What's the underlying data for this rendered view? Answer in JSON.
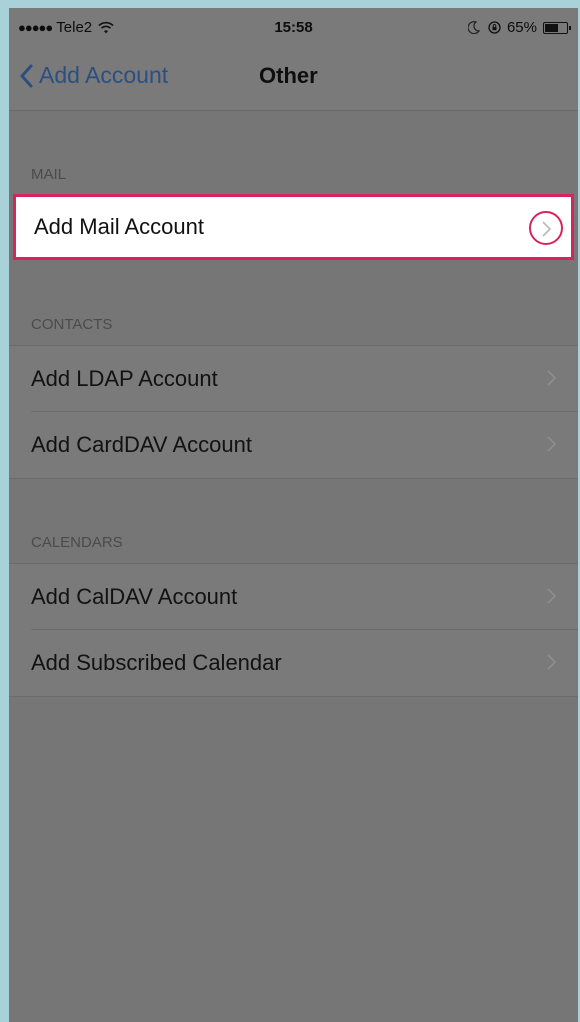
{
  "status_bar": {
    "signal": "●●●●●",
    "carrier": "Tele2",
    "time": "15:58",
    "battery": "65%"
  },
  "nav": {
    "back_label": "Add Account",
    "title": "Other"
  },
  "sections": [
    {
      "header": "MAIL",
      "items": [
        {
          "label": "Add Mail Account"
        }
      ]
    },
    {
      "header": "CONTACTS",
      "items": [
        {
          "label": "Add LDAP Account"
        },
        {
          "label": "Add CardDAV Account"
        }
      ]
    },
    {
      "header": "CALENDARS",
      "items": [
        {
          "label": "Add CalDAV Account"
        },
        {
          "label": "Add Subscribed Calendar"
        }
      ]
    }
  ],
  "colors": {
    "accent": "#2b4f80",
    "highlight_border": "#d8245d",
    "background": "#767676"
  },
  "icons": [
    "wifi-icon",
    "moon-icon",
    "rotation-lock-icon",
    "battery-icon",
    "back-chevron-icon",
    "chevron-right-icon"
  ]
}
